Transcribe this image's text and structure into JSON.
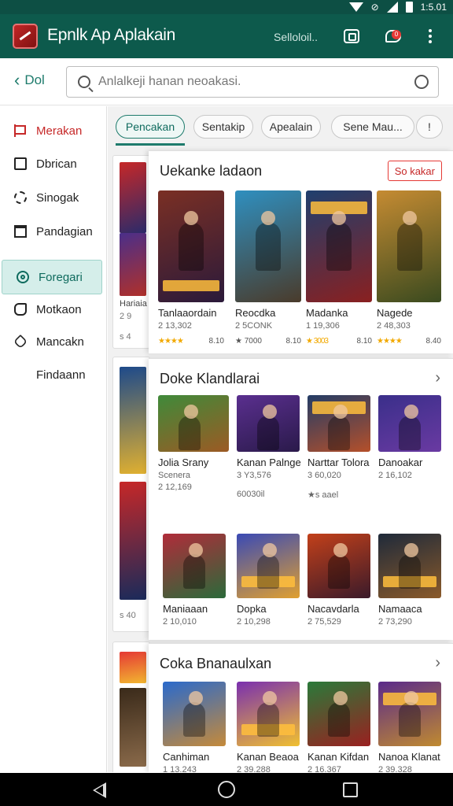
{
  "status_bar": {
    "time": "1:5.01"
  },
  "app_bar": {
    "title": "Epnlk Ap Aplakain",
    "subtitle": "Selloloil..",
    "chat_badge": "0",
    "icons": [
      "camera-icon",
      "chat-icon",
      "more-vert-icon"
    ]
  },
  "search": {
    "back_label": "Dol",
    "placeholder": "Anlalkeji hanan neoakasi."
  },
  "sidebar": {
    "items": [
      {
        "label": "Merakan",
        "icon": "flag-icon",
        "state": "active"
      },
      {
        "label": "Dbrican",
        "icon": "box-icon",
        "state": ""
      },
      {
        "label": "Sinogak",
        "icon": "circle-icon",
        "state": ""
      },
      {
        "label": "Pandagian",
        "icon": "square-icon",
        "state": ""
      },
      {
        "label": "Foregari",
        "icon": "target-icon",
        "state": "selected"
      },
      {
        "label": "Motkaon",
        "icon": "hand-icon",
        "state": ""
      },
      {
        "label": "Mancakn",
        "icon": "tag-icon",
        "state": ""
      },
      {
        "label": "Findaann",
        "icon": "",
        "state": ""
      }
    ]
  },
  "chips": [
    "Pencakan",
    "Sentakip",
    "Apealain",
    "Sene Mau...",
    "!"
  ],
  "background_cards": [
    {
      "label": "Hariaia",
      "sub": "2 9",
      "rating": "s 4"
    },
    {
      "label": "",
      "sub": "",
      "rating": "s 40"
    },
    {
      "label": "",
      "sub": "",
      "rating": ""
    }
  ],
  "panels": [
    {
      "title": "Uekanke ladaon",
      "action": "So kakar",
      "games": [
        {
          "name": "Tanlaaordain",
          "meta": "2 13,302",
          "stars": "★★★★",
          "score": "8.10",
          "colors": [
            "#7a2f24",
            "#2b1a3a"
          ]
        },
        {
          "name": "Reocdka",
          "meta": "2 5CONK",
          "stars": "★ 7000",
          "score": "8.10",
          "colors": [
            "#2f8fbf",
            "#4a3b2b"
          ]
        },
        {
          "name": "Madanka",
          "meta": "1 19,306",
          "stars": "★ 3003",
          "score": "8.10",
          "colors": [
            "#1f3f6e",
            "#8a2020"
          ]
        },
        {
          "name": "Nagede",
          "meta": "2 48,303",
          "stars": "★★★★",
          "score": "8.40",
          "colors": [
            "#c58b32",
            "#3a4a1f"
          ]
        }
      ]
    },
    {
      "title": "Doke Klandlarai",
      "games": [
        {
          "name": "Jolia Srany",
          "meta": "Scenera",
          "sub": "2 12,169",
          "colors": [
            "#3f8a3a",
            "#9c5a24"
          ]
        },
        {
          "name": "Kanan Palnge",
          "meta": "3 Y3,576",
          "sub": "60030il",
          "colors": [
            "#5a2f8f",
            "#2a1a4a"
          ]
        },
        {
          "name": "Narttar Tolora",
          "meta": "3 60,020",
          "sub": "★s aael",
          "colors": [
            "#233c66",
            "#b5502a"
          ]
        },
        {
          "name": "Danoakar",
          "meta": "2 16,102",
          "sub": "",
          "colors": [
            "#3a2f8a",
            "#6a3aa2"
          ]
        },
        {
          "name": "Maniaaan",
          "meta": "2 10,010",
          "colors": [
            "#b02c3a",
            "#2b6a3a"
          ]
        },
        {
          "name": "Dopka",
          "meta": "2 10,298",
          "colors": [
            "#3a4ab5",
            "#e0a030"
          ]
        },
        {
          "name": "Nacavdarla",
          "meta": "2 75,529",
          "colors": [
            "#c2401a",
            "#3a1a2a"
          ]
        },
        {
          "name": "Namaaca",
          "meta": "2 73,290",
          "colors": [
            "#1f2a3a",
            "#8a5a2a"
          ]
        }
      ]
    },
    {
      "title": "Coka Bnanaulxan",
      "games": [
        {
          "name": "Canhiman",
          "meta": "1 13,243",
          "colors": [
            "#2a6acc",
            "#c58a3a"
          ]
        },
        {
          "name": "Kanan Beaoa",
          "meta": "2 39,288",
          "colors": [
            "#7a2faf",
            "#f0c030"
          ]
        },
        {
          "name": "Kanan Kifdan",
          "meta": "2 16,367",
          "colors": [
            "#2a7a3a",
            "#9a2020"
          ]
        },
        {
          "name": "Nanoa Klanat",
          "meta": "2 39,328",
          "colors": [
            "#5a2a8a",
            "#c08a30"
          ]
        }
      ]
    }
  ]
}
